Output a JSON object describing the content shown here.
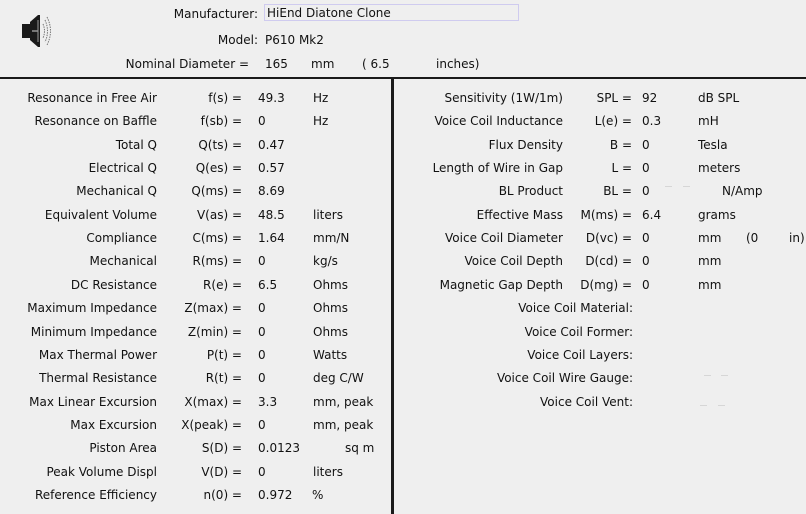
{
  "header": {
    "icon": "speaker-icon",
    "manufacturer_label": "Manufacturer:",
    "manufacturer_value": "HiEnd Diatone Clone",
    "model_label": "Model:",
    "model_value": "P610 Mk2",
    "diameter_label": "Nominal Diameter =",
    "diameter_mm": "165",
    "diameter_mm_unit": "mm",
    "diameter_in_open": "( 6.5",
    "diameter_in_unit": "inches)"
  },
  "left_params": [
    {
      "label": "Resonance in Free Air",
      "symbol": "f(s) =",
      "value": "49.3",
      "unit": "Hz"
    },
    {
      "label": "Resonance on Baffle",
      "symbol": "f(sb) =",
      "value": "0",
      "unit": "Hz"
    },
    {
      "label": "Total Q",
      "symbol": "Q(ts) =",
      "value": "0.47",
      "unit": ""
    },
    {
      "label": "Electrical Q",
      "symbol": "Q(es) =",
      "value": "0.57",
      "unit": ""
    },
    {
      "label": "Mechanical Q",
      "symbol": "Q(ms) =",
      "value": "8.69",
      "unit": ""
    },
    {
      "label": "Equivalent Volume",
      "symbol": "V(as) =",
      "value": "48.5",
      "unit": "liters"
    },
    {
      "label": "Compliance",
      "symbol": "C(ms) =",
      "value": "1.64",
      "unit": "mm/N"
    },
    {
      "label": "Mechanical",
      "symbol": "R(ms) =",
      "value": "0",
      "unit": "kg/s"
    },
    {
      "label": "DC Resistance",
      "symbol": "R(e) =",
      "value": "6.5",
      "unit": "Ohms"
    },
    {
      "label": "Maximum Impedance",
      "symbol": "Z(max) =",
      "value": "0",
      "unit": "Ohms"
    },
    {
      "label": "Minimum Impedance",
      "symbol": "Z(min) =",
      "value": "0",
      "unit": "Ohms"
    },
    {
      "label": "Max Thermal Power",
      "symbol": "P(t) =",
      "value": "0",
      "unit": "Watts"
    },
    {
      "label": "Thermal Resistance",
      "symbol": "R(t) =",
      "value": "0",
      "unit": "deg C/W"
    },
    {
      "label": "Max Linear Excursion",
      "symbol": "X(max) =",
      "value": "3.3",
      "unit": "mm, peak"
    },
    {
      "label": "Max Excursion",
      "symbol": "X(peak) =",
      "value": "0",
      "unit": "mm, peak"
    },
    {
      "label": "Piston Area",
      "symbol": "S(D) =",
      "value": "0.0123",
      "unit": "sq m"
    },
    {
      "label": "Peak Volume Displ",
      "symbol": "V(D) =",
      "value": "0",
      "unit": "liters"
    },
    {
      "label": "Reference Efficiency",
      "symbol": "n(0) =",
      "value": "0.972",
      "unit": "%"
    }
  ],
  "right_params": [
    {
      "label": "Sensitivity (1W/1m)",
      "symbol": "SPL =",
      "value": "92",
      "unit": "dB SPL"
    },
    {
      "label": "Voice Coil Inductance",
      "symbol": "L(e) =",
      "value": "0.3",
      "unit": "mH"
    },
    {
      "label": "Flux Density",
      "symbol": "B =",
      "value": "0",
      "unit": "Tesla"
    },
    {
      "label": "Length of Wire in Gap",
      "symbol": "L =",
      "value": "0",
      "unit": "meters"
    },
    {
      "label": "BL Product",
      "symbol": "BL =",
      "value": "0",
      "unit": "N/Amp"
    },
    {
      "label": "Effective Mass",
      "symbol": "M(ms) =",
      "value": "6.4",
      "unit": "grams"
    },
    {
      "label": "Voice Coil Diameter",
      "symbol": "D(vc) =",
      "value": "0",
      "unit": "mm",
      "extra_open": "(0",
      "extra_unit": "in)"
    },
    {
      "label": "Voice Coil Depth",
      "symbol": "D(cd) =",
      "value": "0",
      "unit": "mm"
    },
    {
      "label": "Magnetic Gap Depth",
      "symbol": "D(mg) =",
      "value": "0",
      "unit": "mm"
    }
  ],
  "right_text_fields": [
    {
      "label": "Voice Coil Material:",
      "value": ""
    },
    {
      "label": "Voice Coil Former:",
      "value": ""
    },
    {
      "label": "Voice Coil Layers:",
      "value": ""
    },
    {
      "label": "Voice Coil Wire Gauge:",
      "value": ""
    },
    {
      "label": "Voice Coil Vent:",
      "value": ""
    }
  ]
}
